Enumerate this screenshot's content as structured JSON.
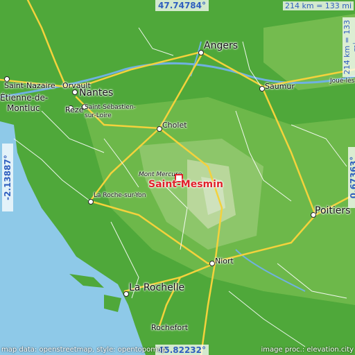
{
  "coords": {
    "top": "47.74784°",
    "bottom": "45.82232°",
    "left": "-2.13887°",
    "right": "0.67363°"
  },
  "scale": {
    "horizontal": "214 km = 133 mi",
    "vertical": "214 km = 133 mi"
  },
  "highlight": {
    "name": "Saint-Mesmin"
  },
  "places": {
    "angers": "Angers",
    "saumur": "Saumur",
    "joue": "Joué-lès",
    "nantes": "Nantes",
    "orvault": "Orvault",
    "stnazaire": "Saint-Nazaire",
    "stetienne": "Étienne-de-",
    "montluc": "Montluc",
    "reze": "Rezé",
    "stseb1": "Saint-Sébastien-",
    "stseb2": "sur-Loire",
    "cholet": "Cholet",
    "montmercure": "Mont Mercure",
    "larochesuryon": "La Roche-sur-Yon",
    "poitiers": "Poitiers",
    "niort": "Niort",
    "larochelle": "La Rochelle",
    "rochefort": "Rochefort"
  },
  "footer": {
    "left": "map data: openstreetmap, style: opentopomap",
    "right": "image proc.: elevation.city"
  },
  "colors": {
    "sea": "#8ec9e8",
    "lowland": "#4fa83a",
    "midland": "#8dc66a",
    "highland": "#c8ddb0",
    "river": "#6fb1e0",
    "road_major": "#f4d23c",
    "road_minor": "#ffffff",
    "accent": "#e0202a",
    "coord_text": "#2f5fbf"
  }
}
